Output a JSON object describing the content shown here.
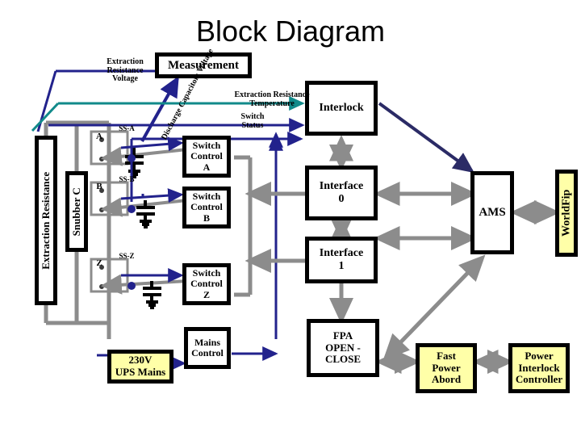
{
  "title": "Block Diagram",
  "colors": {
    "navy": "#22228c",
    "navy_dark": "#2b2b66",
    "teal": "#118a8a",
    "gray": "#8c8c8c",
    "black": "#000000",
    "yellow": "#ffffa8",
    "white": "#ffffff"
  },
  "blocks": {
    "measurement": "Measurement",
    "interlock": "Interlock",
    "interface0": "Interface\n0",
    "interface1": "Interface\n1",
    "ams": "AMS",
    "worldfip": "WorldFip",
    "switch_control_a": "Switch\nControl\nA",
    "switch_control_b": "Switch\nControl\nB",
    "switch_control_z": "Switch\nControl\nZ",
    "extraction_resistance": "Extraction Resistance",
    "snubber_c": "Snubber C",
    "mains_control": "Mains\nControl",
    "ups_mains": "230V\nUPS Mains",
    "fpa": "FPA\nOPEN - CLOSE",
    "fast_power_abord": "Fast\nPower\nAbord",
    "power_interlock_controller": "Power\nInterlock\nController"
  },
  "signals": {
    "extraction_resistance_voltage": "Extraction\nResistance\nVoltage",
    "discharge_capacitors_voltage": "Discharge Capacitors\nVoltage",
    "extraction_resistance_temperature": "Extraction Resistance\nTemperature",
    "switch_status": "Switch\nStatus"
  },
  "switches": {
    "a": "A",
    "b": "B",
    "z": "Z",
    "ss_a": "SS-A",
    "ss_b": "SS-B",
    "ss_z": "SS-Z"
  }
}
